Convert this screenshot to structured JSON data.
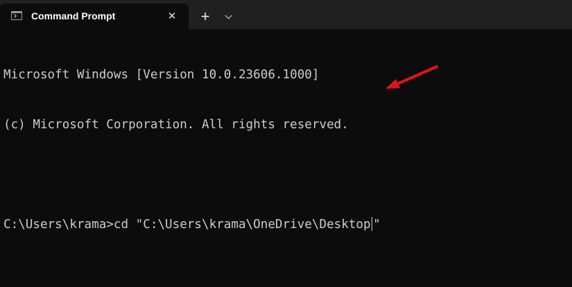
{
  "window": {
    "tab_title": "Command Prompt",
    "tab_close_symbol": "✕",
    "new_tab_symbol": "+",
    "icons": {
      "tab": "terminal-icon",
      "close": "close-icon",
      "new_tab": "plus-icon",
      "dropdown": "chevron-down-icon"
    }
  },
  "terminal": {
    "lines": [
      "Microsoft Windows [Version 10.0.23606.1000]",
      "(c) Microsoft Corporation. All rights reserved.",
      ""
    ],
    "command_before_cursor": "C:\\Users\\krama>cd \"C:\\Users\\krama\\OneDrive\\Desktop",
    "command_after_cursor": "\""
  },
  "annotation": {
    "arrow_color": "#e0121d",
    "arrow_icon": "red-arrow-annotation-icon"
  },
  "colors": {
    "titlebar": "#202020",
    "tab": "#0c0c0c",
    "terminal_background": "#0c0c0c",
    "terminal_text": "#cccccc"
  }
}
